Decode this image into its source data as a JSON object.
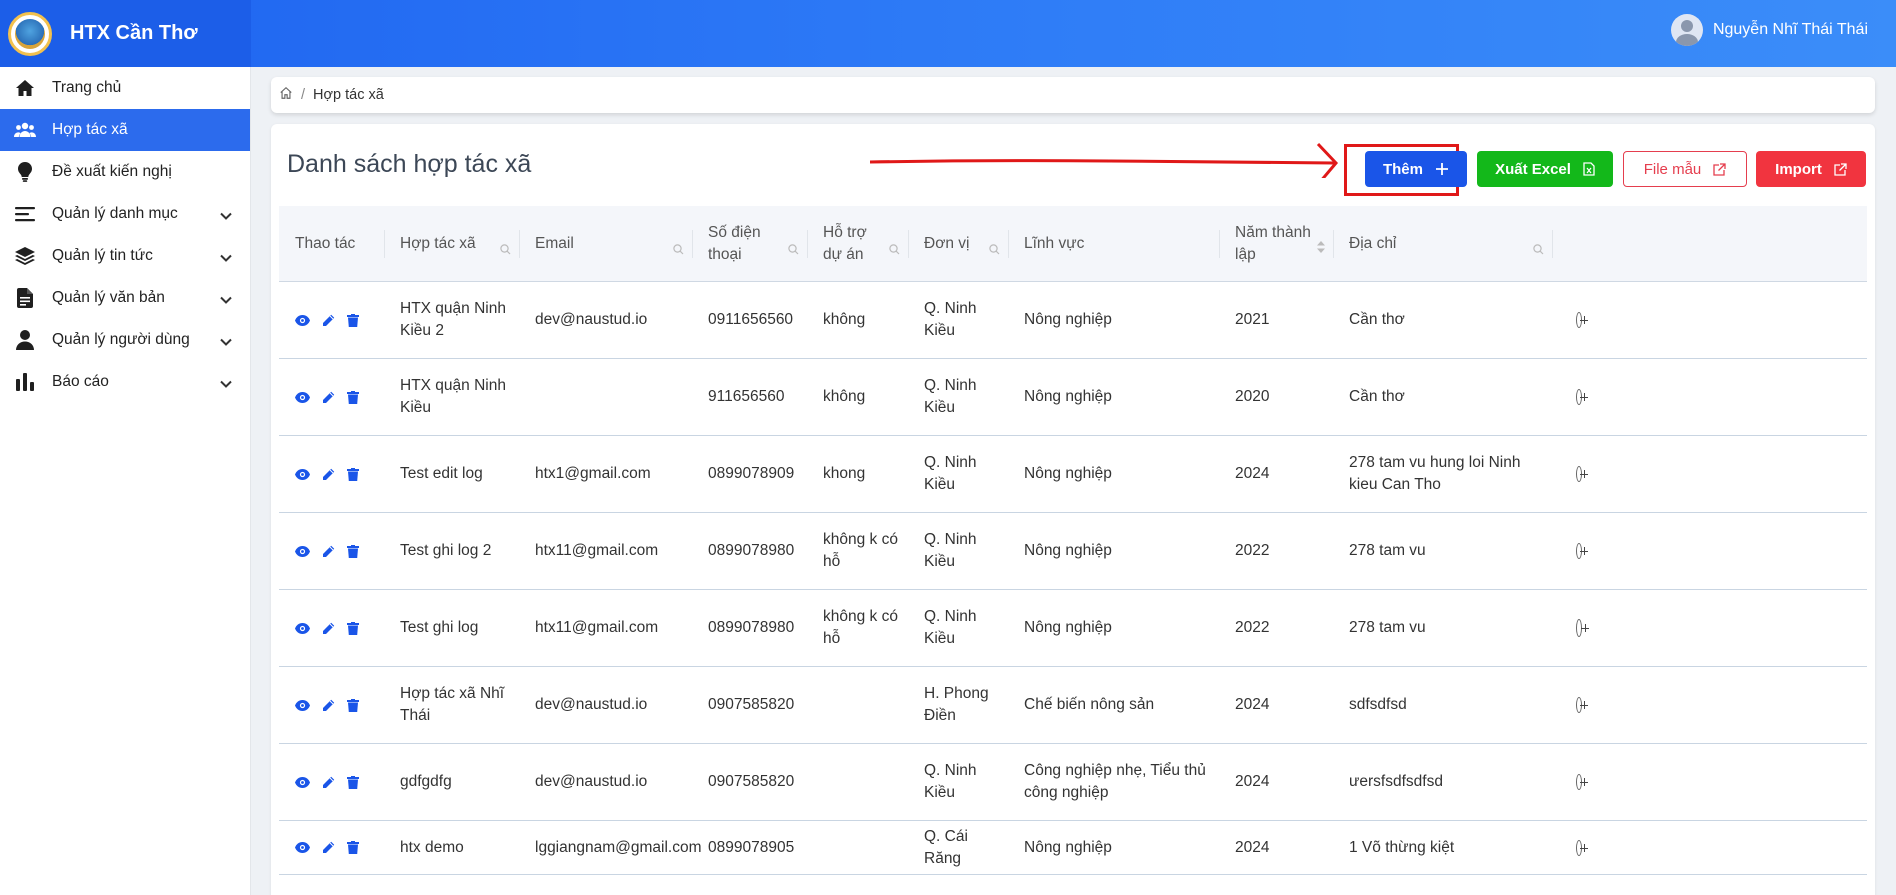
{
  "brand": {
    "title": "HTX Cần Thơ"
  },
  "user": {
    "name": "Nguyễn Nhĩ Thái Thái"
  },
  "sidebar": {
    "items": [
      {
        "label": "Trang chủ",
        "icon": "home-icon",
        "active": false,
        "expandable": false
      },
      {
        "label": "Hợp tác xã",
        "icon": "users-icon",
        "active": true,
        "expandable": false
      },
      {
        "label": "Đề xuất kiến nghị",
        "icon": "lightbulb-icon",
        "active": false,
        "expandable": false
      },
      {
        "label": "Quản lý danh mục",
        "icon": "list-icon",
        "active": false,
        "expandable": true
      },
      {
        "label": "Quản lý tin tức",
        "icon": "layers-icon",
        "active": false,
        "expandable": true
      },
      {
        "label": "Quản lý văn bản",
        "icon": "document-icon",
        "active": false,
        "expandable": true
      },
      {
        "label": "Quản lý người dùng",
        "icon": "user-icon",
        "active": false,
        "expandable": true
      },
      {
        "label": "Báo cáo",
        "icon": "chart-icon",
        "active": false,
        "expandable": true
      }
    ]
  },
  "breadcrumb": {
    "current": "Hợp tác xã"
  },
  "main": {
    "title": "Danh sách hợp tác xã",
    "buttons": {
      "add": "Thêm",
      "excel": "Xuất Excel",
      "template": "File mẫu",
      "import": "Import"
    }
  },
  "table": {
    "columns": [
      "Thao tác",
      "Hợp tác xã",
      "Email",
      "Số điện thoại",
      "Hỗ trợ dự án",
      "Đơn vị",
      "Lĩnh vực",
      "Năm thành lập",
      "Địa chỉ"
    ],
    "rows": [
      {
        "name": "HTX quận Ninh Kiều 2",
        "email": "dev@naustud.io",
        "phone": "0911656560",
        "support": "không",
        "unit": "Q. Ninh Kiều",
        "field": "Nông nghiệp",
        "year": "2021",
        "address": "Cần thơ"
      },
      {
        "name": "HTX quận Ninh Kiều",
        "email": "",
        "phone": "911656560",
        "support": "không",
        "unit": "Q. Ninh Kiều",
        "field": "Nông nghiệp",
        "year": "2020",
        "address": "Cần thơ"
      },
      {
        "name": "Test edit log",
        "email": "htx1@gmail.com",
        "phone": "0899078909",
        "support": "khong",
        "unit": "Q. Ninh Kiều",
        "field": "Nông nghiệp",
        "year": "2024",
        "address": "278 tam vu hung loi Ninh kieu Can Tho"
      },
      {
        "name": "Test ghi log 2",
        "email": "htx11@gmail.com",
        "phone": "0899078980",
        "support": "không k có hỗ",
        "unit": "Q. Ninh Kiều",
        "field": "Nông nghiệp",
        "year": "2022",
        "address": "278 tam vu"
      },
      {
        "name": "Test ghi log",
        "email": "htx11@gmail.com",
        "phone": "0899078980",
        "support": "không k có hỗ",
        "unit": "Q. Ninh Kiều",
        "field": "Nông nghiệp",
        "year": "2022",
        "address": "278 tam vu"
      },
      {
        "name": "Hợp tác xã Nhĩ Thái",
        "email": "dev@naustud.io",
        "phone": "0907585820",
        "support": "",
        "unit": "H. Phong Điền",
        "field": "Chế biến nông sản",
        "year": "2024",
        "address": "sdfsdfsd"
      },
      {
        "name": "gdfgdfg",
        "email": "dev@naustud.io",
        "phone": "0907585820",
        "support": "",
        "unit": "Q. Ninh Kiều",
        "field": "Công nghiệp nhẹ, Tiểu thủ công nghiệp",
        "year": "2024",
        "address": "ưersfsdfsdfsd"
      },
      {
        "name": "htx demo",
        "email": "lggiangnam@gmail.com",
        "phone": "0899078905",
        "support": "",
        "unit": "Q. Cái Răng",
        "field": "Nông nghiệp",
        "year": "2024",
        "address": "1 Võ thừng kiệt"
      }
    ]
  },
  "colors": {
    "primary": "#2c6bed",
    "success": "#13b81a",
    "danger": "#f1343f",
    "annotation": "#e01818"
  }
}
